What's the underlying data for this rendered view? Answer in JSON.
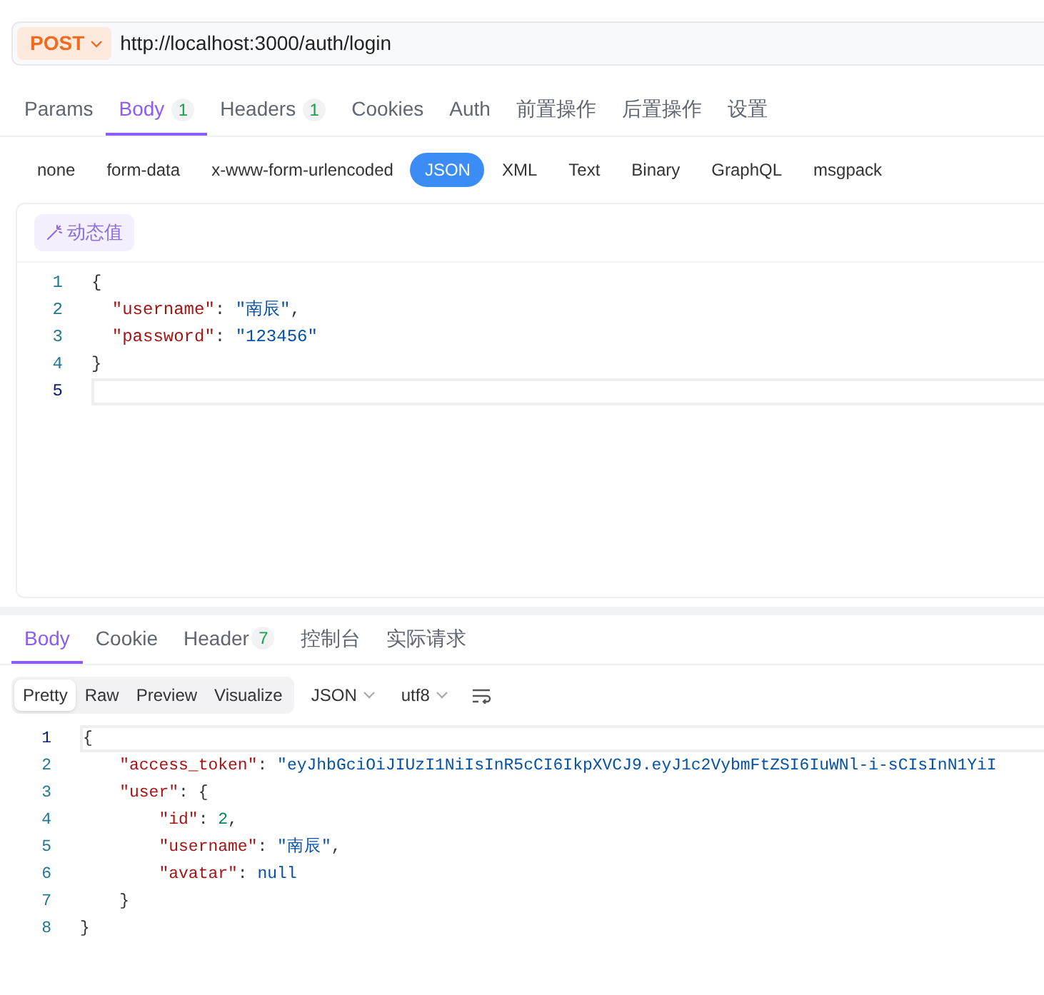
{
  "request": {
    "method": "POST",
    "url": "http://localhost:3000/auth/login",
    "tabs": [
      {
        "label": "Params",
        "selected": false
      },
      {
        "label": "Body",
        "badge": "1",
        "selected": true
      },
      {
        "label": "Headers",
        "badge": "1",
        "selected": false
      },
      {
        "label": "Cookies",
        "selected": false
      },
      {
        "label": "Auth",
        "selected": false
      },
      {
        "label": "前置操作",
        "selected": false
      },
      {
        "label": "后置操作",
        "selected": false
      },
      {
        "label": "设置",
        "selected": false
      }
    ],
    "body_types": [
      {
        "label": "none",
        "selected": false
      },
      {
        "label": "form-data",
        "selected": false
      },
      {
        "label": "x-www-form-urlencoded",
        "selected": false
      },
      {
        "label": "JSON",
        "selected": true
      },
      {
        "label": "XML",
        "selected": false
      },
      {
        "label": "Text",
        "selected": false
      },
      {
        "label": "Binary",
        "selected": false
      },
      {
        "label": "GraphQL",
        "selected": false
      },
      {
        "label": "msgpack",
        "selected": false
      }
    ],
    "dynamic_value_button": "动态值",
    "editor": {
      "lines": [
        {
          "number": "1",
          "active": false,
          "tokens": [
            {
              "kind": "punct",
              "text": "{"
            }
          ]
        },
        {
          "number": "2",
          "active": false,
          "tokens": [
            {
              "kind": "key",
              "text": "  \"username\""
            },
            {
              "kind": "punct",
              "text": ": "
            },
            {
              "kind": "string",
              "text": "\"南辰\""
            },
            {
              "kind": "punct",
              "text": ","
            }
          ]
        },
        {
          "number": "3",
          "active": false,
          "tokens": [
            {
              "kind": "key",
              "text": "  \"password\""
            },
            {
              "kind": "punct",
              "text": ": "
            },
            {
              "kind": "string",
              "text": "\"123456\""
            }
          ]
        },
        {
          "number": "4",
          "active": false,
          "tokens": [
            {
              "kind": "punct",
              "text": "}"
            }
          ]
        },
        {
          "number": "5",
          "active": true
        }
      ]
    }
  },
  "response": {
    "tabs": [
      {
        "label": "Body",
        "selected": true
      },
      {
        "label": "Cookie",
        "selected": false
      },
      {
        "label": "Header",
        "badge": "7",
        "selected": false
      },
      {
        "label": "控制台",
        "selected": false
      },
      {
        "label": "实际请求",
        "selected": false
      }
    ],
    "view_modes": [
      {
        "label": "Pretty",
        "selected": true
      },
      {
        "label": "Raw",
        "selected": false
      },
      {
        "label": "Preview",
        "selected": false
      },
      {
        "label": "Visualize",
        "selected": false
      }
    ],
    "format_select": "JSON",
    "encoding_select": "utf8",
    "code": {
      "lines": [
        {
          "number": "1",
          "active": true,
          "tokens": [
            {
              "kind": "punct",
              "text": "{"
            }
          ]
        },
        {
          "number": "2",
          "active": false,
          "tokens": [
            {
              "kind": "key",
              "text": "    \"access_token\""
            },
            {
              "kind": "punct",
              "text": ": "
            },
            {
              "kind": "string",
              "text": "\"eyJhbGciOiJIUzI1NiIsInR5cCI6IkpXVCJ9.eyJ1c2VybmFtZSI6IuWNl-i-sCIsInN1YiI"
            }
          ]
        },
        {
          "number": "3",
          "active": false,
          "tokens": [
            {
              "kind": "key",
              "text": "    \"user\""
            },
            {
              "kind": "punct",
              "text": ": {"
            }
          ]
        },
        {
          "number": "4",
          "active": false,
          "tokens": [
            {
              "kind": "key",
              "text": "        \"id\""
            },
            {
              "kind": "punct",
              "text": ": "
            },
            {
              "kind": "number",
              "text": "2"
            },
            {
              "kind": "punct",
              "text": ","
            }
          ]
        },
        {
          "number": "5",
          "active": false,
          "tokens": [
            {
              "kind": "key",
              "text": "        \"username\""
            },
            {
              "kind": "punct",
              "text": ": "
            },
            {
              "kind": "string",
              "text": "\"南辰\""
            },
            {
              "kind": "punct",
              "text": ","
            }
          ]
        },
        {
          "number": "6",
          "active": false,
          "tokens": [
            {
              "kind": "key",
              "text": "        \"avatar\""
            },
            {
              "kind": "punct",
              "text": ": "
            },
            {
              "kind": "null",
              "text": "null"
            }
          ]
        },
        {
          "number": "7",
          "active": false,
          "tokens": [
            {
              "kind": "punct",
              "text": "    }"
            }
          ]
        },
        {
          "number": "8",
          "active": false,
          "tokens": [
            {
              "kind": "punct",
              "text": "}"
            }
          ]
        }
      ]
    }
  }
}
